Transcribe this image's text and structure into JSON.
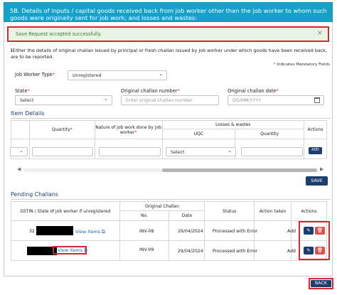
{
  "header": {
    "title": "5B. Details of inputs / capital goods received back from job worker other than the job worker to whom such goods were originally sent for job work; and losses and wastes:"
  },
  "alert": {
    "message": "Save Request accepted successfully.",
    "close": "×"
  },
  "info_text": "Either the details of original challan issued by principal or fresh challan issued by job worker under which goods have been received back, are to be reported.",
  "mandatory_note": "Indicates Mandatory Fields",
  "form": {
    "job_worker_type_label": "Job Worker Type",
    "job_worker_type_value": "Unregistered",
    "state_label": "State",
    "state_value": "Select",
    "challan_number_label": "Original challan number",
    "challan_number_placeholder": "Enter original challan number",
    "challan_date_label": "Original challan date",
    "challan_date_placeholder": "DD/MM/YYYY"
  },
  "item_details": {
    "title": "Item Details",
    "headers": {
      "quantity": "Quantity",
      "nature": "Nature of job work done by job worker",
      "losses": "Losses & wastes",
      "uqc": "UQC",
      "loss_quantity": "Quantity",
      "actions": "Actions"
    },
    "uqc_value": "Select",
    "add_button": "ADD",
    "save_button": "SAVE"
  },
  "pending": {
    "title": "Pending Challans",
    "headers": {
      "gstin": "GSTIN / State of job worker if unregistered",
      "original_challan": "Original Challan",
      "no": "No.",
      "date": "Date",
      "status": "Status",
      "action_taken": "Action taken",
      "actions": "Actions"
    },
    "rows": [
      {
        "gstin_prefix": "32",
        "view": "View Items",
        "no": "INV-08",
        "date": "29/04/2024",
        "status": "Processed with Error",
        "action": "Add"
      },
      {
        "gstin_prefix": "",
        "view": "View Items",
        "no": "INV-09",
        "date": "29/04/2024",
        "status": "Processed with Error",
        "action": "Add"
      }
    ]
  },
  "back_button": "BACK",
  "colors": {
    "header": "#16a2c8",
    "primary_button": "#1d3c70",
    "delete_button": "#d9534f",
    "highlight": "#d12b31",
    "alert_bg": "#e9f5e4"
  }
}
